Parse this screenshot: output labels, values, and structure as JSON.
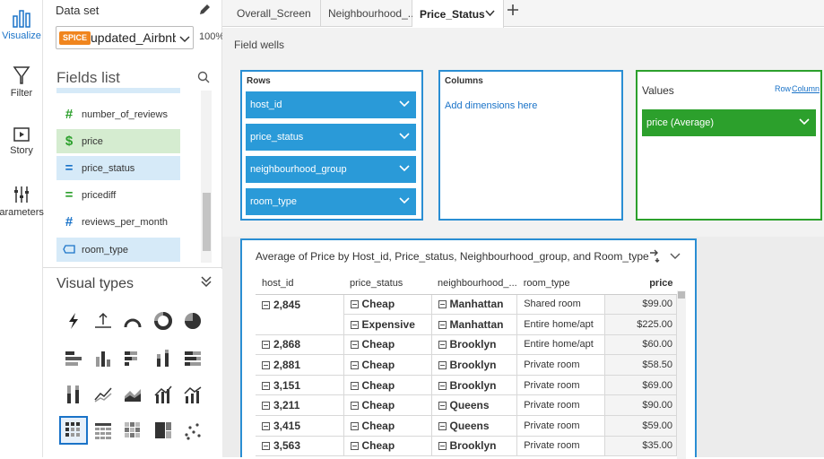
{
  "rail": {
    "items": [
      {
        "label": "Visualize",
        "icon": "bar-chart-icon",
        "active": true
      },
      {
        "label": "Filter",
        "icon": "funnel-icon"
      },
      {
        "label": "Story",
        "icon": "play-icon"
      },
      {
        "label": "Parameters",
        "icon": "sliders-icon"
      }
    ]
  },
  "dataset": {
    "label": "Data set",
    "badge": "SPICE",
    "name": "updated_Airbnb_...",
    "percent": "100%"
  },
  "fields": {
    "title": "Fields list",
    "items": [
      {
        "name": "number_of_reviews",
        "type": "measure",
        "icon": "#"
      },
      {
        "name": "price",
        "type": "measure-selected",
        "icon": "$"
      },
      {
        "name": "price_status",
        "type": "dimension-selected",
        "icon": "="
      },
      {
        "name": "pricediff",
        "type": "measure-green",
        "icon": "="
      },
      {
        "name": "reviews_per_month",
        "type": "measure",
        "icon": "#"
      },
      {
        "name": "room_type",
        "type": "dimension-selected",
        "icon": "tag"
      }
    ]
  },
  "visual_types": {
    "title": "Visual types",
    "collapse": "⌄⌄"
  },
  "tabs": [
    {
      "label": "Overall_Screen"
    },
    {
      "label": "Neighbourhood_..."
    },
    {
      "label": "Price_Status",
      "active": true
    }
  ],
  "field_wells": {
    "label": "Field wells",
    "rows": {
      "title": "Rows",
      "items": [
        "host_id",
        "price_status",
        "neighbourhood_group",
        "room_type"
      ]
    },
    "columns": {
      "title": "Columns",
      "placeholder": "Add dimensions here"
    },
    "values": {
      "title": "Values",
      "row_link": "Row",
      "col_link": "Column",
      "items": [
        "price (Average)"
      ]
    }
  },
  "visual": {
    "title": "Average of Price by Host_id, Price_status, Neighbourhood_group, and Room_type",
    "headers": [
      "host_id",
      "price_status",
      "neighbourhood_...",
      "room_type",
      "price"
    ],
    "rows": [
      {
        "host_id": "2,845",
        "price_status": "Cheap",
        "neighbourhood": "Manhattan",
        "room_type": "Shared room",
        "price": "$99.00"
      },
      {
        "host_id": "",
        "price_status": "Expensive",
        "neighbourhood": "Manhattan",
        "room_type": "Entire home/apt",
        "price": "$225.00"
      },
      {
        "host_id": "2,868",
        "price_status": "Cheap",
        "neighbourhood": "Brooklyn",
        "room_type": "Entire home/apt",
        "price": "$60.00"
      },
      {
        "host_id": "2,881",
        "price_status": "Cheap",
        "neighbourhood": "Brooklyn",
        "room_type": "Private room",
        "price": "$58.50"
      },
      {
        "host_id": "3,151",
        "price_status": "Cheap",
        "neighbourhood": "Brooklyn",
        "room_type": "Private room",
        "price": "$69.00"
      },
      {
        "host_id": "3,211",
        "price_status": "Cheap",
        "neighbourhood": "Queens",
        "room_type": "Private room",
        "price": "$90.00"
      },
      {
        "host_id": "3,415",
        "price_status": "Cheap",
        "neighbourhood": "Queens",
        "room_type": "Private room",
        "price": "$59.00"
      },
      {
        "host_id": "3,563",
        "price_status": "Cheap",
        "neighbourhood": "Brooklyn",
        "room_type": "Private room",
        "price": "$35.00"
      }
    ]
  },
  "colors": {
    "accent": "#1a73c8",
    "pill_blue": "#2a9ad8",
    "pill_green": "#2ca02c",
    "spice": "#f0851e"
  }
}
